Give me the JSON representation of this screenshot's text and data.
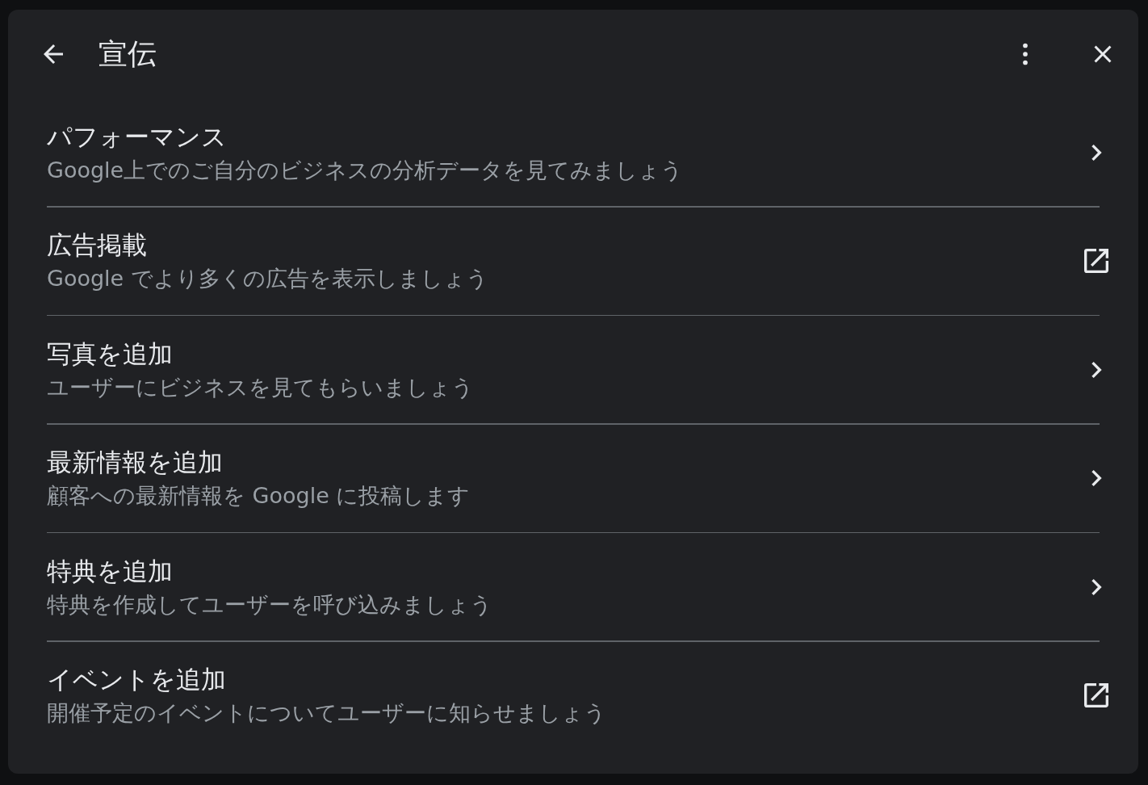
{
  "dialog": {
    "title": "宣伝"
  },
  "items": [
    {
      "title": "パフォーマンス",
      "subtitle": "Google上でのご自分のビジネスの分析データを見てみましょう",
      "kind": "chevron"
    },
    {
      "title": "広告掲載",
      "subtitle": "Google でより多くの広告を表示しましょう",
      "kind": "external"
    },
    {
      "title": "写真を追加",
      "subtitle": "ユーザーにビジネスを見てもらいましょう",
      "kind": "chevron"
    },
    {
      "title": "最新情報を追加",
      "subtitle": "顧客への最新情報を Google に投稿します",
      "kind": "chevron"
    },
    {
      "title": "特典を追加",
      "subtitle": "特典を作成してユーザーを呼び込みましょう",
      "kind": "chevron"
    },
    {
      "title": "イベントを追加",
      "subtitle": "開催予定のイベントについてユーザーに知らせましょう",
      "kind": "external"
    }
  ]
}
